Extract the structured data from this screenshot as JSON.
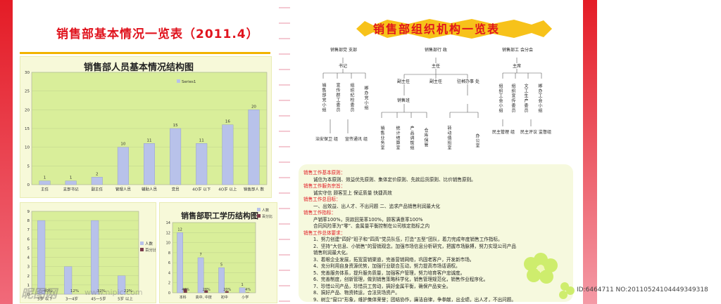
{
  "page": {
    "left_title": "销售部基本情况一览表（2011.4）",
    "right_title": "销售部组织机构一览表",
    "watermark_left": "昵图网",
    "watermark_url": "www.nipic.com",
    "footer": "ID:6464711 NO:20110524104449349318"
  },
  "chart_data": [
    {
      "type": "bar",
      "title": "销售部人员基本情况结构图",
      "legend": [
        "Series1"
      ],
      "categories": [
        "主任",
        "支部书记",
        "副主任",
        "管理人员",
        "辅助人员",
        "党员",
        "4O岁 以下",
        "4O岁 以上",
        "销售部人 数"
      ],
      "values": [
        1,
        1,
        2,
        10,
        11,
        15,
        11,
        16,
        20
      ],
      "ylim": [
        0,
        30
      ],
      "yticks": [
        "0",
        "5",
        "10",
        "15",
        "20",
        "25",
        "30"
      ],
      "colors": {
        "bar": "#b8c2ea",
        "plot": "#d9ee9a"
      }
    },
    {
      "type": "bar",
      "title": "",
      "legend": [
        "人数",
        "百分比"
      ],
      "categories": [
        "5岁 以下",
        "3一4岁",
        "45一5岁",
        "5岁 以上"
      ],
      "series": [
        {
          "name": "人数",
          "values": [
            8,
            3,
            8,
            2
          ]
        },
        {
          "name": "百分比",
          "values": [
            0,
            0,
            0,
            0
          ]
        }
      ],
      "data_labels": [
        "40%",
        "12%",
        "32%",
        "22%"
      ],
      "ylim": [
        0,
        9
      ],
      "yticks": [
        "0",
        "1",
        "2",
        "3",
        "4",
        "5",
        "6",
        "7",
        "8",
        "9"
      ],
      "colors": {
        "bar": "#b8c2ea",
        "plot": "#d9ee9a"
      }
    },
    {
      "type": "bar",
      "title": "销售部职工学历结构图",
      "legend": [
        "人数",
        "百分比"
      ],
      "categories": [
        "本科",
        "高中, 中技",
        "初中",
        "小学"
      ],
      "series": [
        {
          "name": "人数",
          "values": [
            12,
            7,
            5,
            1
          ]
        },
        {
          "name": "百分比",
          "values": [
            0.48,
            0.28,
            0.2,
            0.04
          ]
        }
      ],
      "value_labels": [
        "12",
        "7",
        "5",
        "1"
      ],
      "data_labels": [
        "48%",
        "28%",
        "20%",
        "4%"
      ],
      "ylim": [
        0,
        14
      ],
      "yticks": [
        "0",
        "2",
        "4",
        "6",
        "8",
        "10",
        "12",
        "14"
      ],
      "colors": {
        "bar": "#b8c2ea",
        "bar2": "#7a3a4a",
        "plot": "#d9ee9a"
      }
    }
  ],
  "org": {
    "top": [
      "销售部党 支部",
      "销售部行 政",
      "销售部工 会分会"
    ],
    "level2": [
      "书记",
      "主任",
      "主席"
    ],
    "level3": [
      "副主任",
      "副主任",
      "驻郴办事 处"
    ],
    "party_units": [
      "销售部党小组",
      "宣传群工委员",
      "组织纪检委员",
      "郴办党小组"
    ],
    "sales_unit": "销售班",
    "sales_teams": [
      "销售业务室",
      "统计结算室",
      "产品调拔组",
      "仓库保管"
    ],
    "office_units": [
      "转动值班室",
      "办公室"
    ],
    "party_sub": [
      "治安保卫 组",
      "宣传通讯 组"
    ],
    "union_units": [
      "组织工会小组",
      "组织宣传委员",
      "文工生产委员",
      "郴办工会小组"
    ],
    "union_sub": [
      "民主管理 组",
      "民主评议 监督组"
    ]
  },
  "principles": [
    {
      "text": "销售工作基本原则：",
      "red": true
    },
    {
      "text": "诚信为本原则、效益优先原则、集体定价原则、先款后货原则、比价销售原则。",
      "red": false
    },
    {
      "text": "销售工作服务宗旨：",
      "red": true
    },
    {
      "text": "诚实守信        顾客至上        保证质量        快捷高效",
      "red": false
    },
    {
      "text": "销售工作总目标：",
      "red": true
    },
    {
      "text": "一、出效益、出人才、不出问题        二、追求产品销售利润最大化",
      "red": false
    },
    {
      "text": "销售工作指标：",
      "red": true
    },
    {
      "text": "产销率100%，货款回笼率100%，顾客满意率100%",
      "red": false
    },
    {
      "text": "合同风险率为“零”、金属量平衡控制在公司核定指标之内",
      "red": false
    },
    {
      "text": "销售工作总体要求：",
      "red": true
    },
    {
      "text": "1、努力创建“四好”班子和“四高”党员队伍，打造“五型”团队，着力完成年度销售工作指标。",
      "red": false
    },
    {
      "text": "2、坚持“大信息、小销售”的营销观念，加强市场信息分析研究，把握市场脉搏，努力实现公司产品",
      "red": false
    },
    {
      "text": "销售利润最大化。",
      "red": false
    },
    {
      "text": "3、着眼企业发展，拓宽营销渠道，完善营销网络，巩固老客户，开发新市场。",
      "red": false
    },
    {
      "text": "4、充分利用自身资源优势，加强行业联合互动，努力提高市场话语权。",
      "red": false
    },
    {
      "text": "5、完善服务体系，提升服务质量，加强客户管理，努力培育客户忠诚度。",
      "red": false
    },
    {
      "text": "6、完善制度，创新管理，做到销售策略科学化，销售管理规范化，销售作业程序化。",
      "red": false
    },
    {
      "text": "7、珍惜公司产品，珍惜员工劳动，搞好金属平衡，确保产品安全。",
      "red": false
    },
    {
      "text": "8、搞好产品、物资转运，合法货场资产。",
      "red": false
    },
    {
      "text": "9、树立“窗口”形象，维护集体荣誉；团结协作，廉洁自律，争拳献，出业绩，出人才，不出问题。",
      "red": false
    }
  ]
}
